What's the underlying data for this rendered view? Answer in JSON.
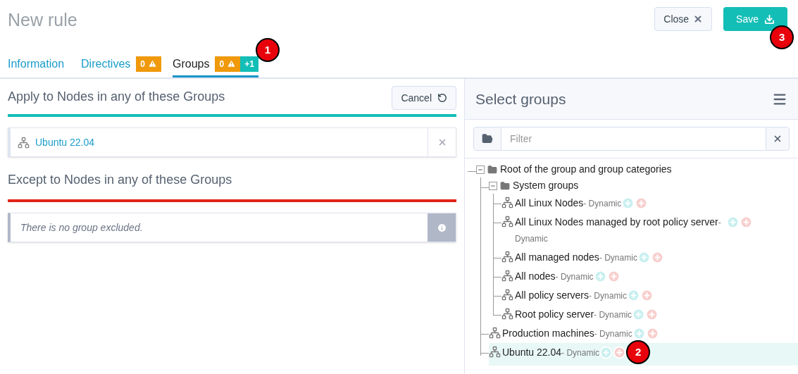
{
  "page": {
    "title": "New rule"
  },
  "actions": [
    {
      "kind": "close",
      "label": "Close"
    },
    {
      "kind": "save",
      "label": "Save",
      "callout": "3"
    }
  ],
  "tabs": [
    {
      "label": "Information",
      "selected": false
    },
    {
      "label": "Directives",
      "selected": false,
      "badges": [
        {
          "kind": "warning",
          "text": "0"
        }
      ]
    },
    {
      "label": "Groups",
      "selected": true,
      "badges": [
        {
          "kind": "warning",
          "text": "0"
        },
        {
          "kind": "added",
          "text": "+1"
        }
      ],
      "callout": "1"
    }
  ],
  "include": {
    "title": "Apply to Nodes in any of these Groups",
    "cancel": "Cancel",
    "groups": [
      "Ubuntu 22.04"
    ]
  },
  "exclude": {
    "title": "Except to Nodes in any of these Groups",
    "empty_message": "There is no group excluded."
  },
  "selector": {
    "title": "Select groups",
    "filter": {
      "placeholder": "Filter"
    },
    "tree": [
      {
        "kind": "category",
        "name": "Root of the group and group categories",
        "expanded": true,
        "children": [
          {
            "kind": "category",
            "name": "System groups",
            "expanded": true,
            "children": [
              {
                "kind": "group",
                "name": "All Linux Nodes",
                "type": "- Dynamic",
                "selected": false
              },
              {
                "kind": "group",
                "name": "All Linux Nodes managed by root policy server",
                "type": "- Dynamic",
                "selected": false
              },
              {
                "kind": "group",
                "name": "All managed nodes",
                "type": "- Dynamic",
                "selected": false
              },
              {
                "kind": "group",
                "name": "All nodes",
                "type": "- Dynamic",
                "selected": false
              },
              {
                "kind": "group",
                "name": "All policy servers",
                "type": "- Dynamic",
                "selected": false
              },
              {
                "kind": "group",
                "name": "Root policy server",
                "type": "- Dynamic",
                "selected": false
              }
            ]
          },
          {
            "kind": "group",
            "name": "Production machines",
            "type": "- Dynamic",
            "selected": false
          },
          {
            "kind": "group",
            "name": "Ubuntu 22.04",
            "type": "- Dynamic",
            "selected": true,
            "callout": "2"
          }
        ]
      }
    ]
  }
}
